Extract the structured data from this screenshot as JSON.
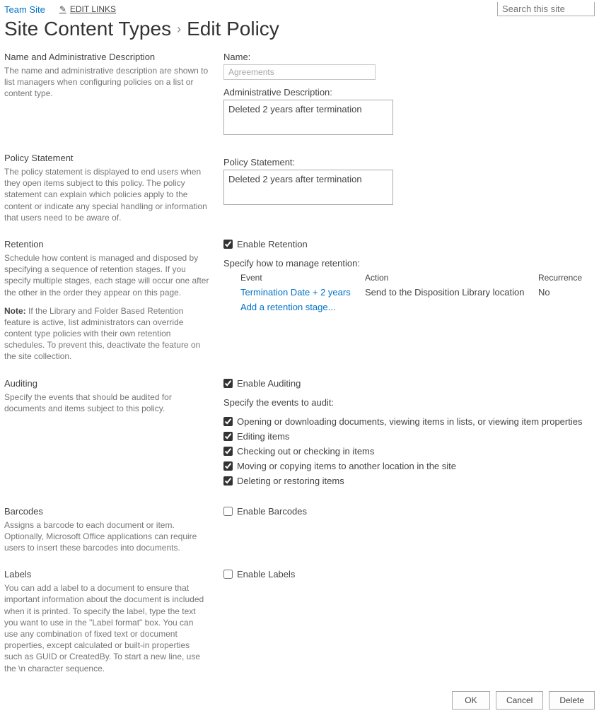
{
  "topbar": {
    "team_site": "Team Site",
    "edit_links": "EDIT LINKS",
    "search_placeholder": "Search this site"
  },
  "title": {
    "parent": "Site Content Types",
    "current": "Edit Policy"
  },
  "sections": {
    "nameAdmin": {
      "heading": "Name and Administrative Description",
      "desc": "The name and administrative description are shown to list managers when configuring policies on a list or content type.",
      "name_label": "Name:",
      "name_value": "Agreements",
      "admin_label": "Administrative Description:",
      "admin_value": "Deleted 2 years after termination"
    },
    "policyStatement": {
      "heading": "Policy Statement",
      "desc": "The policy statement is displayed to end users when they open items subject to this policy. The policy statement can explain which policies apply to the content or indicate any special handling or information that users need to be aware of.",
      "label": "Policy Statement:",
      "value": "Deleted 2 years after termination"
    },
    "retention": {
      "heading": "Retention",
      "desc": "Schedule how content is managed and disposed by specifying a sequence of retention stages. If you specify multiple stages, each stage will occur one after the other in the order they appear on this page.",
      "note_label": "Note:",
      "note": " If the Library and Folder Based Retention feature is active, list administrators can override content type policies with their own retention schedules.  To prevent this, deactivate the feature on the site collection.",
      "enable_label": "Enable Retention",
      "specify_label": "Specify how to manage retention:",
      "cols": {
        "event": "Event",
        "action": "Action",
        "recurrence": "Recurrence"
      },
      "row": {
        "event": "Termination Date + 2 years",
        "action": "Send to the Disposition Library location",
        "recurrence": "No"
      },
      "add_stage": "Add a retention stage..."
    },
    "auditing": {
      "heading": "Auditing",
      "desc": "Specify the events that should be audited for documents and items subject to this policy.",
      "enable_label": "Enable Auditing",
      "specify_label": "Specify the events to audit:",
      "events": [
        "Opening or downloading documents, viewing items in lists, or viewing item properties",
        "Editing items",
        "Checking out or checking in items",
        "Moving or copying items to another location in the site",
        "Deleting or restoring items"
      ]
    },
    "barcodes": {
      "heading": "Barcodes",
      "desc": "Assigns a barcode to each document or item. Optionally, Microsoft Office applications can require users to insert these barcodes into documents.",
      "enable_label": "Enable Barcodes"
    },
    "labels": {
      "heading": "Labels",
      "desc": "You can add a label to a document to ensure that important information about the document is included when it is printed. To specify the label, type the text you want to use in the \"Label format\" box. You can use any combination of fixed text or document properties, except calculated or built-in properties such as GUID or CreatedBy. To start a new line, use the \\n character sequence.",
      "enable_label": "Enable Labels"
    }
  },
  "buttons": {
    "ok": "OK",
    "cancel": "Cancel",
    "delete": "Delete"
  }
}
